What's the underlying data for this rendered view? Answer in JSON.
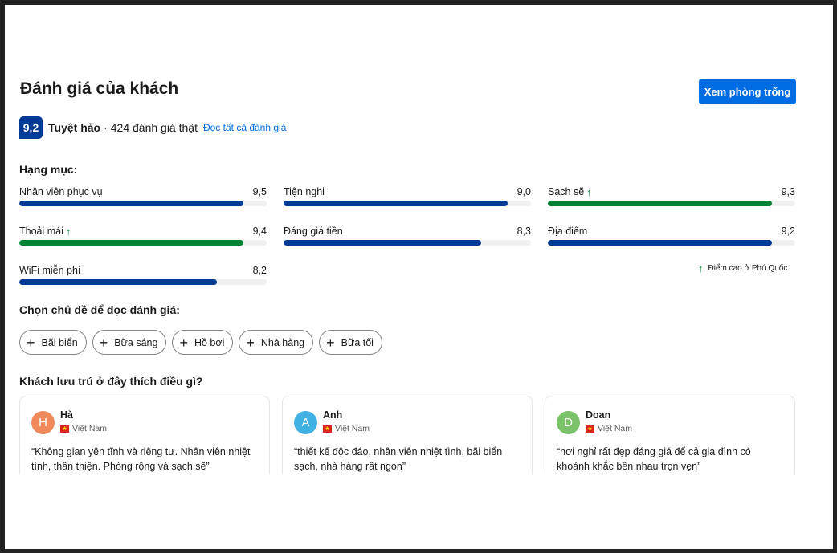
{
  "header": {
    "title": "Đánh giá của khách",
    "cta_label": "Xem phòng trống"
  },
  "score": {
    "value": "9,2",
    "word": "Tuyệt hảo",
    "separator": "·",
    "count_text": "424 đánh giá thật",
    "read_all": "Đọc tất cả đánh giá"
  },
  "categories": {
    "heading": "Hạng mục:",
    "items": [
      {
        "name": "Nhân viên phục vụ",
        "score": "9,5",
        "fraction": 0.905,
        "highlight": false
      },
      {
        "name": "Tiện nghi",
        "score": "9,0",
        "fraction": 0.905,
        "highlight": false
      },
      {
        "name": "Sạch sẽ",
        "score": "9,3",
        "fraction": 0.905,
        "highlight": true
      },
      {
        "name": "Thoải mái",
        "score": "9,4",
        "fraction": 0.905,
        "highlight": true
      },
      {
        "name": "Đáng giá tiền",
        "score": "8,3",
        "fraction": 0.8,
        "highlight": false
      },
      {
        "name": "Địa điểm",
        "score": "9,2",
        "fraction": 0.905,
        "highlight": false
      },
      {
        "name": "WiFi miễn phí",
        "score": "8,2",
        "fraction": 0.8,
        "highlight": false
      }
    ],
    "high_score_note": "Điểm cao ở Phú Quốc"
  },
  "topics": {
    "heading": "Chọn chủ đề để đọc đánh giá:",
    "chips": [
      "Bãi biển",
      "Bữa sáng",
      "Hồ bơi",
      "Nhà hàng",
      "Bữa tối"
    ]
  },
  "reviews": {
    "heading": "Khách lưu trú ở đây thích điều gì?",
    "items": [
      {
        "initial": "H",
        "name": "Hà",
        "country": "Việt Nam",
        "avatar_color": "#f08a5d",
        "text": "“Không gian yên tĩnh và riêng tư. Nhân viên nhiệt tình, thân thiện. Phòng rộng và sạch sẽ”"
      },
      {
        "initial": "A",
        "name": "Anh",
        "country": "Việt Nam",
        "avatar_color": "#3fb1e3",
        "text": "“thiết kế độc đáo, nhân viên nhiệt tình, bãi biển sạch, nhà hàng rất ngon”"
      },
      {
        "initial": "D",
        "name": "Doan",
        "country": "Việt Nam",
        "avatar_color": "#7cc26b",
        "text": "“nơi nghỉ rất đẹp đáng giá để cả gia đình có khoảnh khắc bên nhau trọn vẹn”"
      }
    ]
  },
  "colors": {
    "brand_blue": "#003b95",
    "action_blue": "#006ce4",
    "highlight_green": "#008234"
  },
  "icons": {
    "arrow_up": "↑",
    "plus": "+",
    "flag_star": "★"
  }
}
